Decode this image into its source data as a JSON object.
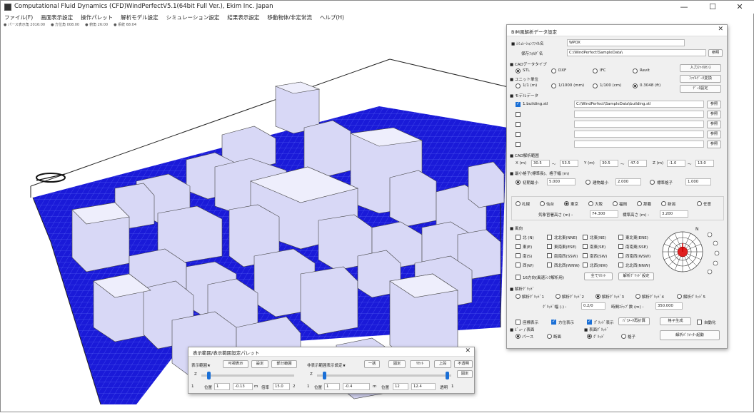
{
  "window": {
    "title": "Computational Fluid Dynamics (CFD)WindPerfectV5.1(64bit Full Ver.), Ekim Inc. Japan",
    "minimize": "—",
    "maximize": "☐",
    "close": "✕"
  },
  "menu": [
    "ファイル(F)",
    "画面表示設定",
    "操作パレット",
    "解析モデル設定",
    "シミュレーション設定",
    "結果表示設定",
    "移動物体/非定常流",
    "ヘルプ(H)"
  ],
  "status_top": [
    "● パース表示角 2016:00",
    "● 方位角 008.00",
    "● 俯角 26:00",
    "● 系統 68:04"
  ],
  "bottom_status": [
    "",
    ""
  ],
  "bim": {
    "title": "BIM風解析データ設定",
    "close": "✕",
    "project_label": "■ ｼﾐｭﾚｰｼｮﾝﾌｧｲﾙ名",
    "project_value": "WPOX",
    "folder_label": "保存ﾌｫﾙﾀﾞ名",
    "folder_value": "C:\\WindPerfect\\SampleData\\",
    "browse": "参照",
    "cad_type_label": "■ CADデータタイプ",
    "cad_types": [
      "STL",
      "DXF",
      "IFC",
      "Revit"
    ],
    "cad_type_selected": 0,
    "import_btn": "入力ﾌｧｲﾙｾﾝｽ",
    "unit_label": "■ ユニット単位",
    "units": [
      "1/1 (m)",
      "1/1000 (mm)",
      "1/100 (cm)",
      "0.3048 (ft)"
    ],
    "unit_selected": 3,
    "unit_btn1": "ﾌｧｲﾙﾃﾞｰﾀ変換",
    "unit_btn2": "ﾃﾞｰﾀ設定",
    "model_label": "■ モデルデータ",
    "model_rows": [
      {
        "name": "1.building.stl",
        "path": "C:\\WindPerfect\\SampleData\\building.stl",
        "checked": true
      },
      {
        "name": "",
        "path": "",
        "checked": false
      },
      {
        "name": "",
        "path": "",
        "checked": false
      },
      {
        "name": "",
        "path": "",
        "checked": false
      },
      {
        "name": "",
        "path": "",
        "checked": false
      }
    ],
    "range_label": "■ CAD解析範囲",
    "x_label": "X (m)",
    "x_min": "30.5",
    "x_max": "53.5",
    "y_label": "Y (m)",
    "y_min": "30.5",
    "y_max": "47.0",
    "z_label": "Z (m)",
    "z_min": "-1.0",
    "z_max": "13.0",
    "tilde": "〜",
    "mesh_label": "■ 最小格子(標準長)、格子幅 (m)",
    "mesh_opts": [
      {
        "label": "初期最小",
        "value": "5.000",
        "on": true
      },
      {
        "label": "建物最小",
        "value": "2.000",
        "on": false
      },
      {
        "label": "標準格子",
        "value": "1.000",
        "on": false
      }
    ],
    "regions": [
      "札幌",
      "仙台",
      "東京",
      "大阪",
      "福岡",
      "那覇",
      "新潟",
      "任意"
    ],
    "region_selected": 2,
    "ref_wind_label": "気象官署高さ (m) :",
    "ref_wind_value": "74.300",
    "ref_height_label": "標準高さ (m) :",
    "ref_height_value": "3.200",
    "wind_dir_label": "■ 風向",
    "wind_dirs": [
      [
        "北 (N)",
        "北北東(NNE)",
        "北東(NE)",
        "東北東(ENE)"
      ],
      [
        "東(E)",
        "東南東(ESE)",
        "南東(SE)",
        "南南東(SSE)"
      ],
      [
        "南(S)",
        "南南西(SSW)",
        "南西(SW)",
        "西南西(WSW)"
      ],
      [
        "西(W)",
        "西北西(WNW)",
        "北西(NW)",
        "北北西(NNW)"
      ]
    ],
    "dir16_label": "16方向(風速ﾗﾝｸ解析用)",
    "select_all": "全てﾘｾｯﾄ",
    "compass_setting": "解析ｸﾞﾘｯﾄﾞ設定",
    "compass_n": "N",
    "grid_label": "■ 解析ｸﾞﾘｯﾄﾞ",
    "grid_opts": [
      "解析ｸﾞﾘｯﾄﾞ1",
      "解析ｸﾞﾘｯﾄﾞ2",
      "解析ｸﾞﾘｯﾄﾞ3",
      "解析ｸﾞﾘｯﾄﾞ4",
      "解析ｸﾞﾘｯﾄﾞ5"
    ],
    "grid_selected": 2,
    "grid_f1_label": "ｸﾞﾘｯﾄﾞ幅 (-) :",
    "grid_f1": "0.2/0",
    "grid_f2_label": "時間ｽﾃｯﾌﾟ数 (m) :",
    "grid_f2": "350.000",
    "opt_checks": [
      {
        "label": "座標表示",
        "on": false
      },
      {
        "label": "方位表示",
        "on": true
      },
      {
        "label": "ｸﾞﾘｯﾄﾞ表示",
        "on": true
      }
    ],
    "param_btn": "ﾊﾟﾗﾒｰﾀ再計算",
    "exec_btn": "格子生成",
    "auto_label": "自動化",
    "view_label": "■ ﾋﾞｭｰ / 表面",
    "view_opts": [
      "パース",
      "断面"
    ],
    "calc_label": "■ 表面ｸﾞﾘｯﾄﾞ",
    "calc_opts": [
      "ｸﾞﾘｯﾄﾞ",
      "格子"
    ],
    "run_btn": "解析ﾊﾟﾗﾒｰﾀｰ起動"
  },
  "palette": {
    "title": "表示範囲/表示範囲設定パレット",
    "close": "✕",
    "left_label": "表示範囲★",
    "btn1": "可視表示",
    "btn2": "設定",
    "btn3": "部分範囲",
    "axis1": "Z",
    "pos_label": "位置",
    "pos_val": "1",
    "v1": "-0.13",
    "unit_m": "m",
    "ratio_label": "倍率",
    "ratio_val": "15.0",
    "mid_label": "非表示範囲表示設定★",
    "mid_btn": "一括",
    "axis2": "Z",
    "pos2_val": "1",
    "v2": "-0.4",
    "fix_btn": "固定",
    "reset_btn": "ﾘｾｯﾄ",
    "top_btn": "上段",
    "nondisp_btn": "不透明",
    "pos3_label": "位置",
    "pos3_val": "12",
    "v3": "12.4",
    "disp_btn": "表示",
    "bottom_label": "透明",
    "num_a": "1",
    "num_b": "2",
    "num_c": "1",
    "fix_setting": "固定"
  }
}
